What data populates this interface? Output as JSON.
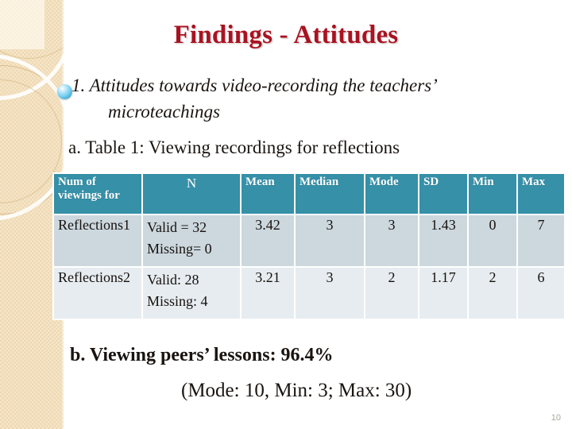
{
  "slide": {
    "title": "Findings - Attitudes",
    "title_color": "#a81321",
    "page_number": "10"
  },
  "bullet": {
    "icon": "blue-sphere-bullet",
    "line1": "1. Attitudes towards video-recording the teachers’",
    "line2": "microteachings"
  },
  "subheading": {
    "text": "a. Table 1: Viewing recordings for reflections"
  },
  "table": {
    "header_bg": "#3590a8",
    "row_a_bg": "#ccd7de",
    "row_b_bg": "#e6ecf0",
    "headers": {
      "label_line1": "Num of",
      "label_line2": "viewings for",
      "n": "N",
      "mean": "Mean",
      "median": "Median",
      "mode": "Mode",
      "sd": "SD",
      "min": "Min",
      "max": "Max"
    },
    "rows": [
      {
        "label": "Reflections1",
        "n_valid": "Valid = 32",
        "n_missing": "Missing= 0",
        "mean": "3.42",
        "median": "3",
        "mode": "3",
        "sd": "1.43",
        "min": "0",
        "max": "7"
      },
      {
        "label": "Reflections2",
        "n_valid": "Valid: 28",
        "n_missing": "Missing: 4",
        "mean": "3.21",
        "median": "3",
        "mode": "2",
        "sd": "1.17",
        "min": "2",
        "max": "6"
      }
    ]
  },
  "footer": {
    "line1": "b. Viewing peers’ lessons: 96.4%",
    "line2": "(Mode: 10, Min: 3; Max: 30)"
  }
}
